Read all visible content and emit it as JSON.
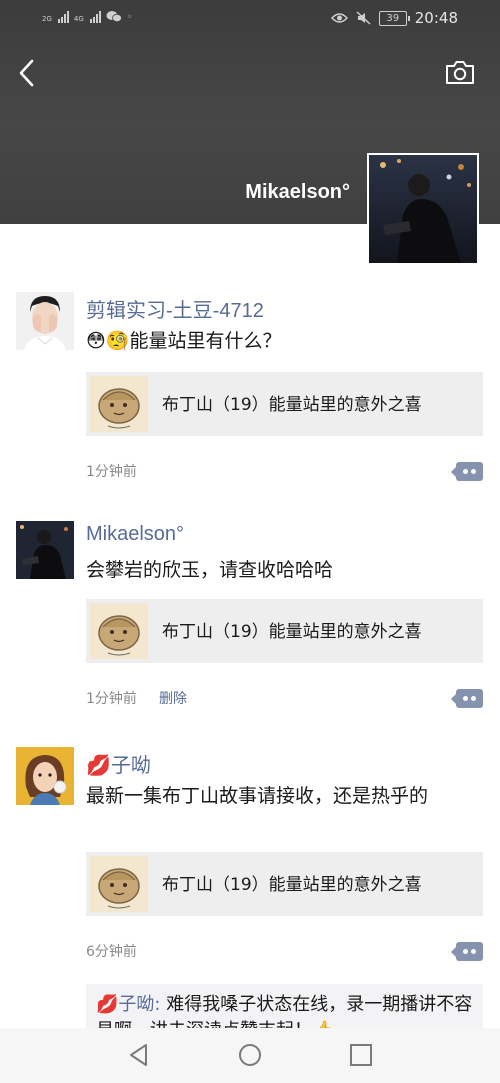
{
  "status_bar": {
    "network_1": "2G",
    "network_2": "4G",
    "battery": "39",
    "time": "20:48"
  },
  "header": {
    "profile_name": "Mikaelson°"
  },
  "posts": [
    {
      "nickname": "剪辑实习-土豆-4712",
      "emoji": "😳🧐",
      "text": "能量站里有什么？",
      "link_title": "布丁山（19）能量站里的意外之喜",
      "time": "1分钟前"
    },
    {
      "nickname": "Mikaelson°",
      "text": "会攀岩的欣玉，请查收哈哈哈",
      "link_title": "布丁山（19）能量站里的意外之喜",
      "time": "1分钟前",
      "delete_label": "删除"
    },
    {
      "nickname": "子呦",
      "nickname_emoji": "💋",
      "text": "最新一集布丁山故事请接收，还是热乎的",
      "link_title": "布丁山（19）能量站里的意外之喜",
      "time": "6分钟前"
    }
  ],
  "comment": {
    "emoji": "💋",
    "author": "子呦:",
    "text": " 难得我嗓子状态在线，录一期播讲不容易啊，讲去深读点赞支起！👍"
  },
  "colors": {
    "link_blue": "#576b95",
    "header_gray": "#444444",
    "card_bg": "#eeeeee"
  },
  "icons": [
    "back-arrow-icon",
    "camera-icon",
    "more-dots-icon",
    "nav-back-icon",
    "nav-home-icon",
    "nav-recents-icon"
  ]
}
